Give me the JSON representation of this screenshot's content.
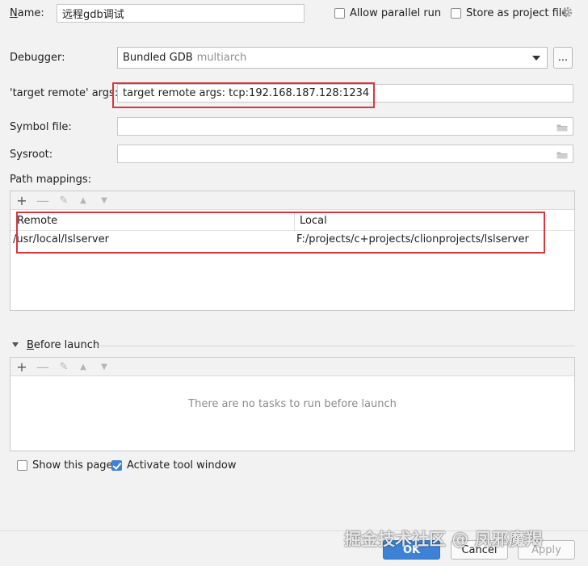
{
  "name_row": {
    "label": "Name:",
    "value": "远程gdb调试",
    "allow_parallel": "Allow parallel run",
    "store_project": "Store as project file"
  },
  "debugger": {
    "label": "Debugger:",
    "value": "Bundled GDB",
    "hint": "multiarch",
    "more_button": "..."
  },
  "target_remote": {
    "label": "'target remote' args:",
    "value": "target remote args:  tcp:192.168.187.128:1234"
  },
  "symbol_file": {
    "label": "Symbol file:",
    "value": ""
  },
  "sysroot": {
    "label": "Sysroot:",
    "value": ""
  },
  "path_mappings": {
    "label": "Path mappings:",
    "columns": [
      "Remote",
      "Local"
    ],
    "rows": [
      {
        "remote": "/usr/local/lslserver",
        "local": "F:/projects/c+projects/clionprojects/lslserver"
      }
    ]
  },
  "before_launch": {
    "label": "Before launch",
    "empty_text": "There are no tasks to run before launch"
  },
  "options": {
    "show_page": "Show this page",
    "activate_tool": "Activate tool window"
  },
  "buttons": {
    "ok": "OK",
    "cancel": "Cancel",
    "apply": "Apply"
  },
  "watermark": "掘金技术社区 @ 凤邪魔羯",
  "colors": {
    "accent": "#3d82d4",
    "highlight_box": "#d9363e"
  }
}
